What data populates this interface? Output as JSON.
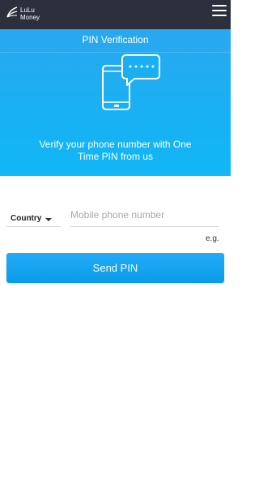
{
  "brand": {
    "line1": "LuLu",
    "line2": "Money"
  },
  "icons": {
    "logo": "lulu-logo-icon",
    "menu": "hamburger-menu-icon",
    "illustration": "phone-message-icon",
    "caret": "caret-down-icon"
  },
  "hero": {
    "title": "PIN Verification",
    "description": "Verify your phone number with One Time PIN from us"
  },
  "form": {
    "country_label": "Country",
    "phone_placeholder": "Mobile phone number",
    "example_label": "e.g.",
    "submit_label": "Send PIN"
  },
  "colors": {
    "topbar": "#2c2f3c",
    "hero": "#19b0f3",
    "button": "#15a3ef"
  }
}
